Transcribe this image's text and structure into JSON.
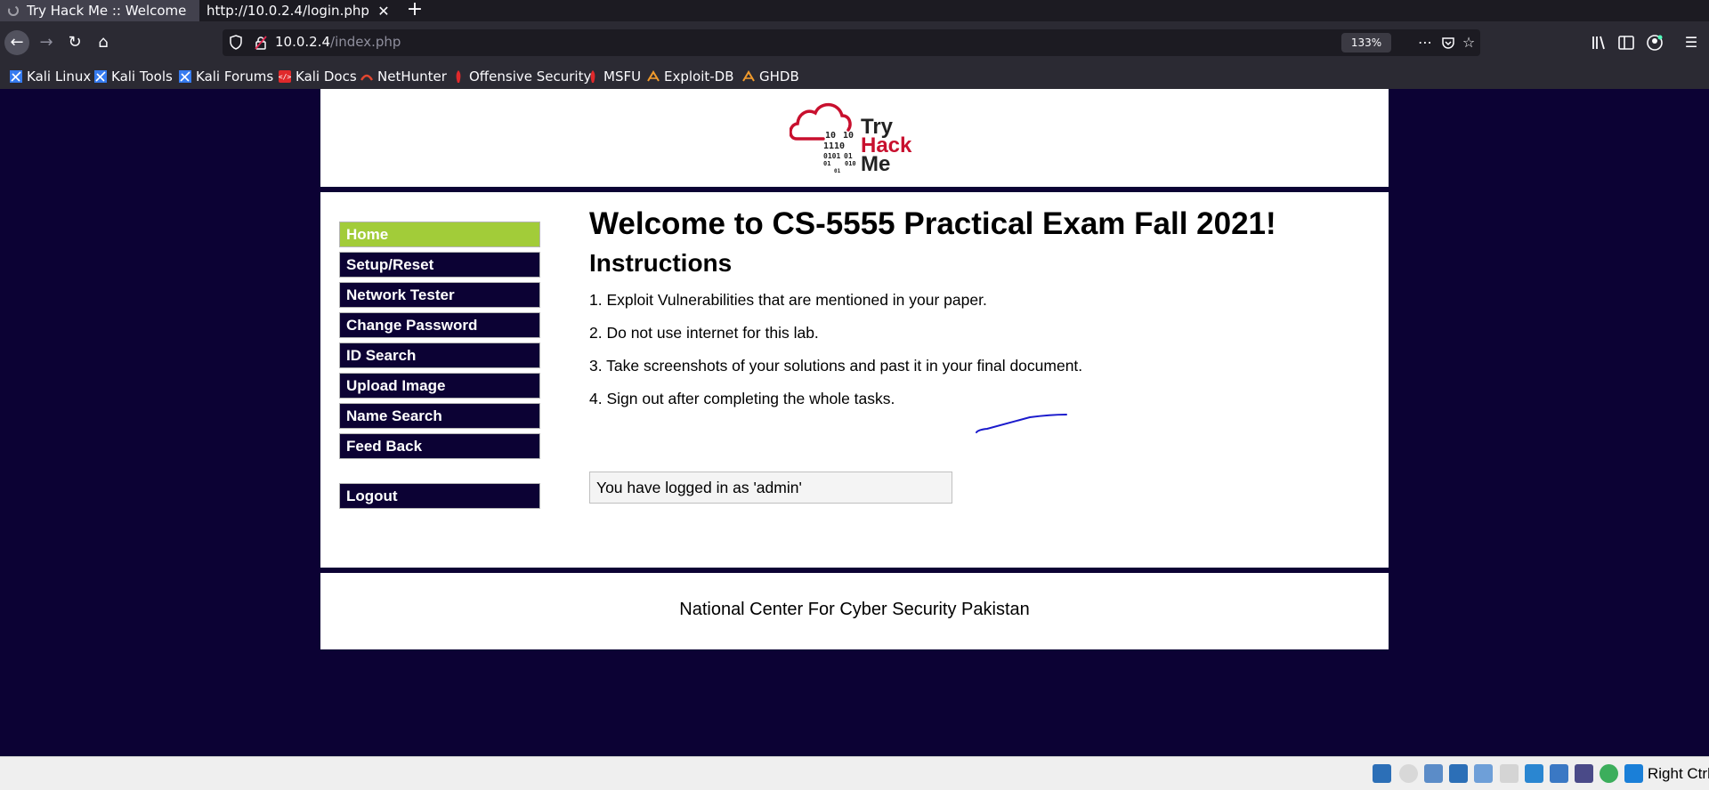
{
  "browser": {
    "tabs": [
      {
        "title": "Try Hack Me :: Welcome",
        "active": true
      },
      {
        "title": "http://10.0.2.4/login.php",
        "active": false
      }
    ],
    "url_host": "10.0.2.4",
    "url_path": "/index.php",
    "zoom": "133%",
    "bookmarks": [
      "Kali Linux",
      "Kali Tools",
      "Kali Forums",
      "Kali Docs",
      "NetHunter",
      "Offensive Security",
      "MSFU",
      "Exploit-DB",
      "GHDB"
    ]
  },
  "logo": {
    "lines": [
      "Try",
      "Hack",
      "Me"
    ]
  },
  "sidebar": {
    "items": [
      "Home",
      "Setup/Reset",
      "Network Tester",
      "Change Password",
      "ID Search",
      "Upload Image",
      "Name Search",
      "Feed Back"
    ],
    "selected": "Home",
    "logout": "Logout"
  },
  "content": {
    "title": "Welcome to CS-5555 Practical Exam Fall 2021!",
    "subtitle": "Instructions",
    "instructions": [
      "1. Exploit Vulnerabilities that are mentioned in your paper.",
      "2. Do not use internet for this lab.",
      "3. Take screenshots of your solutions and past it in your final document.",
      "4. Sign out after completing the whole tasks."
    ],
    "login_status": "You have logged in as 'admin'"
  },
  "footer": {
    "text": "National Center For Cyber Security Pakistan"
  },
  "vm_statusbar": {
    "host_key": "Right Ctrl"
  },
  "colors": {
    "page_bg": "#0c0234",
    "menu_bg": "#0c0234",
    "menu_selected": "#a2cc39",
    "logo_red": "#c8102e"
  }
}
